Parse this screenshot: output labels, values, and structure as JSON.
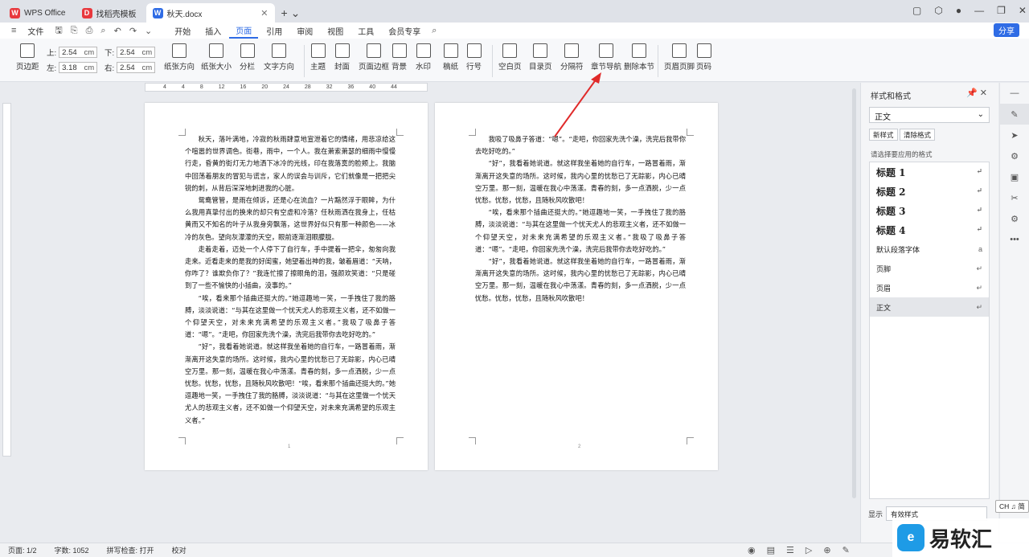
{
  "tabs": [
    {
      "label": "WPS Office",
      "logo": "W",
      "color": "#e8383d"
    },
    {
      "label": "找稻壳模板",
      "logo": "D",
      "color": "#e8383d"
    },
    {
      "label": "秋天.docx",
      "logo": "W",
      "color": "#2f6ce5"
    }
  ],
  "menu": {
    "file": "文件",
    "items": [
      "开始",
      "插入",
      "页面",
      "引用",
      "审阅",
      "视图",
      "工具",
      "会员专享"
    ],
    "active": "页面",
    "share": "分享"
  },
  "ribbon": {
    "margins_label": "页边距",
    "top_label": "上:",
    "top": "2.54",
    "bottom_label": "下:",
    "bottom": "2.54",
    "left_label": "左:",
    "left": "3.18",
    "right_label": "右:",
    "right": "2.54",
    "unit": "cm",
    "buttons": [
      "纸张方向",
      "纸张大小",
      "分栏",
      "文字方向",
      "主题",
      "封面",
      "页面边框",
      "背景",
      "水印",
      "稿纸",
      "行号",
      "空白页",
      "目录页",
      "分隔符",
      "章节导航",
      "删除本节",
      "页眉页脚",
      "页码"
    ]
  },
  "ruler": {
    "ticks": [
      "4",
      "4",
      "8",
      "12",
      "16",
      "20",
      "24",
      "28",
      "32",
      "36",
      "40",
      "44"
    ]
  },
  "page1": {
    "paragraphs": [
      "秋天，落叶满地，冷寂的秋雨肆意地宣泄着它的情绪，用悲凉给这个喧嚣的世界调色。街巷，雨中，一个人。我在萧索萧瑟的细雨中慢慢行走，昏黄的街灯无力地洒下冰冷的光线，印在我落寞的脸颊上。我脑中回荡着朋友的冒犯与谎言，家人的误会与训斥，它们就像是一把把尖锐的刺，从背后深深地刺进我的心脏。",
      "鸳鸯管管，是雨在倾诉，还是心在流血？一片黯然浮于眼眸，为什么我用真挚付出的换来的却只有空虚和冷落？任秋雨洒在我身上，任枯黄而又不知名的叶子从我身旁飘落，这世界好似只有那一种颜色——冰冷的灰色。望向灰濛濛的天空，眼前逐渐泪眼朦胧。",
      "走着走着，迈处一个人停下了自行车，手中提着一把伞，匆匆向我走来。近看走来的是我的好闺蜜，她望着出神的我，皱着眉道：“天呐，你咋了？谁欺负你了？”我连忙擦了擦眼角的泪，强颜欢笑道：“只是碰到了一些不愉快的小插曲，没事的。”",
      "“唉，看来那个插曲还挺大的。”她逗趣地一笑，一手拽住了我的胳膊，淡淡说道：“与其在这里做一个忧天尤人的悲观主义者，还不如做一个仰望天空，对未来充满希望的乐观主义者。”我吸了吸鼻子答道：“嗯”。“走吧，你回家先洗个澡，洗完后我带你去吃好吃的。”",
      "“好”，我看着她说道。就这样我坐着她的自行车，一路冒着雨，渐渐离开这失意的场所。这时候，我内心里的忧愁已了无踪影，内心已晴空万里。那一刻，温暖在我心中荡漾。青春的刻，多一点洒脱，少一点忧愁。忧愁，忧愁，且随秋风吹散吧！“唉，看来那个插曲还挺大的。”她逗趣地一笑，一手拽住了我的胳膊，淡淡说道：“与其在这里做一个忧天尤人的悲观主义者，还不如做一个仰望天空，对未来充满希望的乐观主义者。”"
    ],
    "num": "1"
  },
  "page2": {
    "paragraphs": [
      "我吸了吸鼻子答道：“嗯”。“走吧，你回家先洗个澡，洗完后我带你去吃好吃的。”",
      "“好”，我看着她说道。就这样我坐着她的自行车，一路冒着雨，渐渐离开这失意的场所。这时候，我内心里的忧愁已了无踪影，内心已晴空万里。那一刻，温暖在我心中荡漾。青春的刻，多一点洒脱，少一点忧愁。忧愁，忧愁，且随秋风吹散吧！",
      "“唉，看来那个插曲还挺大的。”她逗趣地一笑，一手拽住了我的胳膊，淡淡说道：“与其在这里做一个忧天尤人的悲观主义者，还不如做一个仰望天空，对未来充满希望的乐观主义者。”我吸了吸鼻子答道：“嗯”。“走吧，你回家先洗个澡，洗完后我带你去吃好吃的。”",
      "“好”，我看着她说道。就这样我坐着她的自行车，一路冒着雨，渐渐离开这失意的场所。这时候，我内心里的忧愁已了无踪影，内心已晴空万里。那一刻，温暖在我心中荡漾。青春的刻，多一点洒脱，少一点忧愁。忧愁，忧愁，且随秋风吹散吧！"
    ],
    "num": "2"
  },
  "panel": {
    "title": "样式和格式",
    "current": "正文",
    "new_style": "新样式",
    "clear_format": "清除格式",
    "hint": "请选择要应用的格式",
    "styles": [
      "标题 1",
      "标题 2",
      "标题 3",
      "标题 4",
      "默认段落字体",
      "页脚",
      "页眉",
      "正文"
    ],
    "display_label": "显示",
    "display_value": "有效样式"
  },
  "status": {
    "page": "页面: 1/2",
    "words": "字数: 1052",
    "spell": "拼写检查: 打开",
    "proof": "校对"
  },
  "ime": "CH ♫ 简",
  "watermark": {
    "logo": "e",
    "text": "易软汇"
  }
}
